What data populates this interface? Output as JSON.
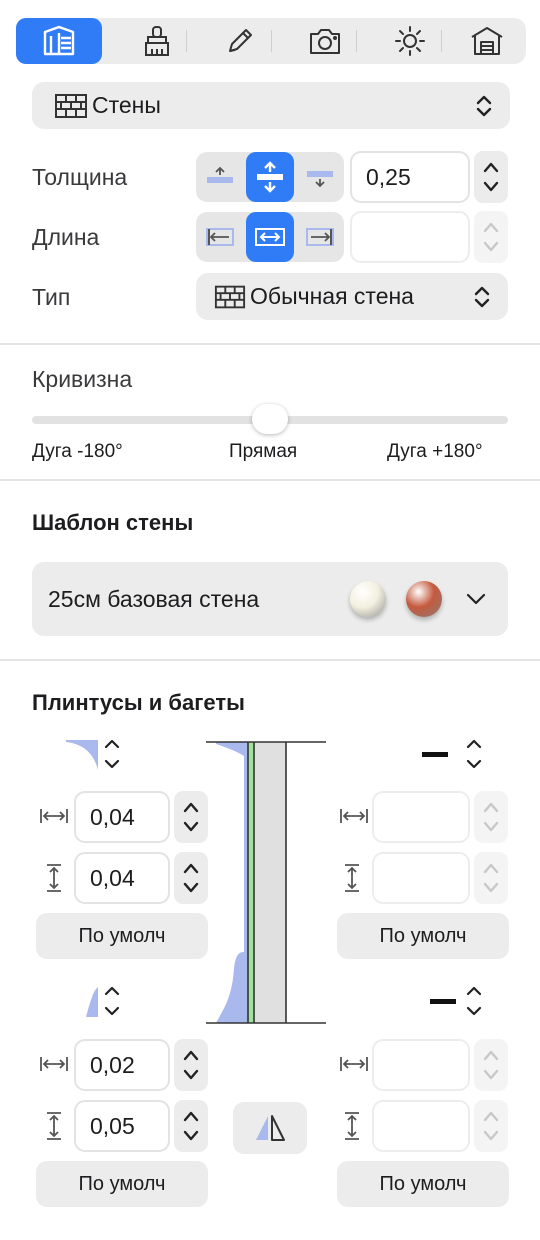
{
  "toolbar": {
    "buttons": [
      {
        "name": "wall-tool-icon",
        "active": true
      },
      {
        "name": "paint-brush-icon",
        "active": false
      },
      {
        "name": "pencil-icon",
        "active": false
      },
      {
        "name": "camera-icon",
        "active": false
      },
      {
        "name": "sun-icon",
        "active": false
      },
      {
        "name": "house-icon",
        "active": false
      }
    ]
  },
  "object_selector": {
    "label": "Стены",
    "icon": "brick-wall-icon"
  },
  "properties": {
    "thickness_label": "Толщина",
    "thickness_value": "0,25",
    "length_label": "Длина",
    "length_value": "",
    "type_label": "Тип",
    "type_value": "Обычная стена"
  },
  "curvature": {
    "label": "Кривизна",
    "value_fraction": 0.5,
    "min_label": "Дуга -180°",
    "mid_label": "Прямая",
    "max_label": "Дуга +180°"
  },
  "template": {
    "title": "Шаблон стены",
    "value": "25см базовая стена",
    "colors": [
      "#f3f0e0",
      "#c55a3e"
    ]
  },
  "mouldings": {
    "title": "Плинтусы и багеты",
    "left_top": {
      "width": "0,04",
      "height": "0,04",
      "default_label": "По умолч"
    },
    "left_bottom": {
      "width": "0,02",
      "height": "0,05",
      "default_label": "По умолч"
    },
    "right_top": {
      "width": "",
      "height": "",
      "default_label": "По умолч"
    },
    "right_bottom": {
      "width": "",
      "height": "",
      "default_label": "По умолч"
    }
  },
  "colors": {
    "accent": "#2f7cf6",
    "control_bg": "#ececec",
    "profile_blue": "#a9b9ee",
    "profile_green": "#9fe39a"
  }
}
